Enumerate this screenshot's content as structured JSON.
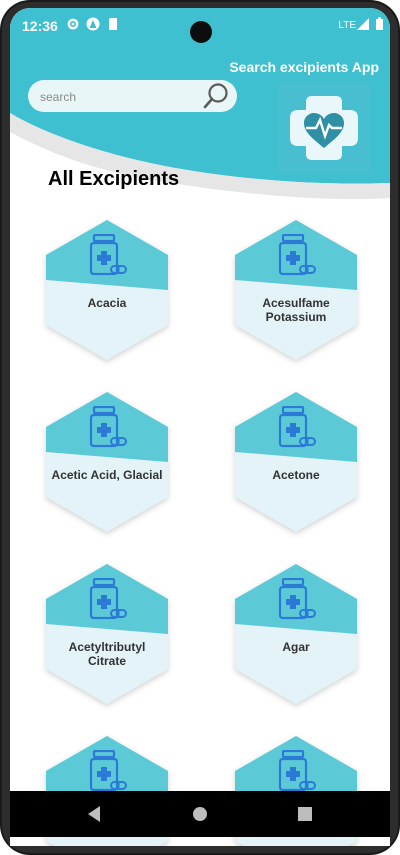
{
  "status_bar": {
    "time": "12:36",
    "network": "LTE"
  },
  "header": {
    "app_title": "Search excipients App",
    "search_placeholder": "search",
    "search_value": ""
  },
  "section_title": "All Excipients",
  "excipients": [
    "Acacia",
    "Acesulfame Potassium",
    "Acetic Acid, Glacial",
    "Acetone",
    "Acetyltributyl Citrate",
    "Agar",
    "",
    ""
  ],
  "colors": {
    "primary": "#3fc0d1",
    "hex_top": "#5ccad6",
    "hex_bottom": "#e3f3f7",
    "icon_blue": "#2b7bd6"
  },
  "nav": [
    "back-icon",
    "home-icon",
    "recents-icon"
  ]
}
